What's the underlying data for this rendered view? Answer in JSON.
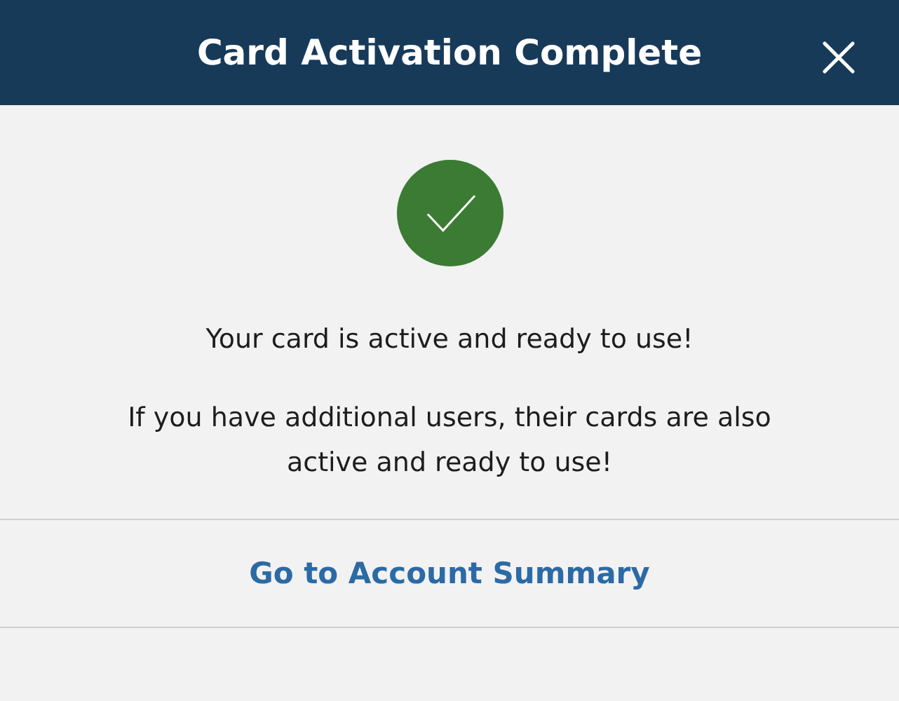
{
  "header": {
    "title": "Card Activation Complete"
  },
  "messages": [
    "Your card is active and ready to use!",
    "If you have additional users, their cards are also active and ready to use!"
  ],
  "link": {
    "label": "Go to Account Summary"
  }
}
